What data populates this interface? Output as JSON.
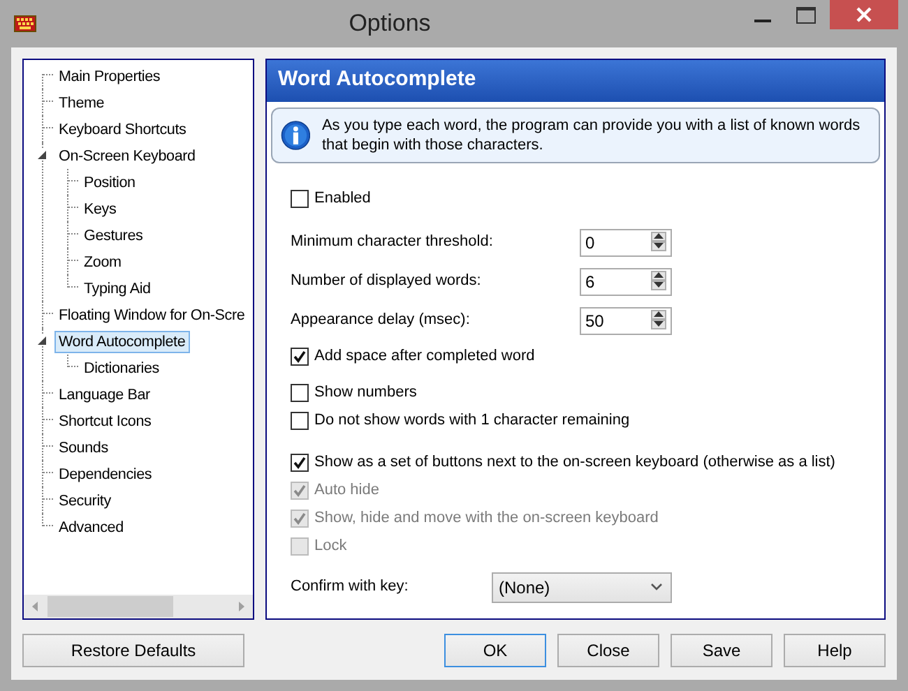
{
  "window": {
    "title": "Options"
  },
  "tree": [
    {
      "label": "Main Properties",
      "selected": false
    },
    {
      "label": "Theme",
      "selected": false
    },
    {
      "label": "Keyboard Shortcuts",
      "selected": false
    },
    {
      "label": "On-Screen Keyboard",
      "selected": false,
      "expanded": true,
      "children": [
        {
          "label": "Position",
          "selected": false
        },
        {
          "label": "Keys",
          "selected": false
        },
        {
          "label": "Gestures",
          "selected": false
        },
        {
          "label": "Zoom",
          "selected": false
        },
        {
          "label": "Typing Aid",
          "selected": false
        }
      ]
    },
    {
      "label": "Floating Window for On-Scre",
      "selected": false
    },
    {
      "label": "Word Autocomplete",
      "selected": true,
      "expanded": true,
      "children": [
        {
          "label": "Dictionaries",
          "selected": false
        }
      ]
    },
    {
      "label": "Language Bar",
      "selected": false
    },
    {
      "label": "Shortcut Icons",
      "selected": false
    },
    {
      "label": "Sounds",
      "selected": false
    },
    {
      "label": "Dependencies",
      "selected": false
    },
    {
      "label": "Security",
      "selected": false
    },
    {
      "label": "Advanced",
      "selected": false
    }
  ],
  "panel": {
    "title": "Word Autocomplete",
    "info": "As you type each word, the program can provide you with a list of known words that begin with those characters.",
    "groups": [
      {
        "items": [
          {
            "kind": "checkbox",
            "label": "Enabled",
            "checked": false,
            "disabled": false
          }
        ]
      },
      {
        "items": [
          {
            "kind": "spin",
            "label": "Minimum character threshold:",
            "value": "0"
          },
          {
            "kind": "spin",
            "label": "Number of displayed words:",
            "value": "6"
          },
          {
            "kind": "spin",
            "label": "Appearance delay (msec):",
            "value": "50"
          }
        ]
      },
      {
        "items": [
          {
            "kind": "checkbox",
            "label": "Add space after completed word",
            "checked": true,
            "disabled": false
          }
        ]
      },
      {
        "items": [
          {
            "kind": "checkbox",
            "label": "Show numbers",
            "checked": false,
            "disabled": false
          },
          {
            "kind": "checkbox",
            "label": "Do not show words with 1 character remaining",
            "checked": false,
            "disabled": false
          }
        ]
      },
      {
        "items": [
          {
            "kind": "checkbox",
            "label": "Show as a set of buttons next to the on-screen keyboard (otherwise as a list)",
            "checked": true,
            "disabled": false
          },
          {
            "kind": "checkbox",
            "label": "Auto hide",
            "checked": true,
            "disabled": true
          },
          {
            "kind": "checkbox",
            "label": "Show, hide and move with the on-screen keyboard",
            "checked": true,
            "disabled": true
          },
          {
            "kind": "checkbox",
            "label": "Lock",
            "checked": false,
            "disabled": true
          }
        ]
      },
      {
        "items": [
          {
            "kind": "select",
            "label": "Confirm with key:",
            "value": "(None)"
          }
        ]
      }
    ]
  },
  "buttons": [
    {
      "label": "Restore Defaults",
      "default": false
    },
    {
      "label": "OK",
      "default": true
    },
    {
      "label": "Close",
      "default": false
    },
    {
      "label": "Save",
      "default": false
    },
    {
      "label": "Help",
      "default": false
    }
  ]
}
